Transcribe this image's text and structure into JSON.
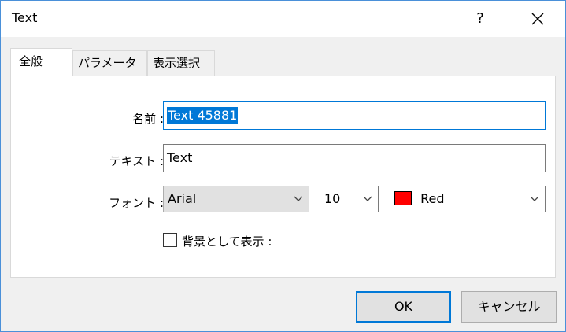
{
  "window": {
    "title": "Text",
    "help_label": "?"
  },
  "tabs": [
    {
      "label": "全般",
      "active": true
    },
    {
      "label": "パラメーター",
      "active": false
    },
    {
      "label": "表示選択",
      "active": false
    }
  ],
  "form": {
    "name_label": "名前 :",
    "name_value": "Text 45881",
    "text_label": "テキスト :",
    "text_value": "Text",
    "font_label": "フォント :",
    "font_family": "Arial",
    "font_size": "10",
    "color_name": "Red",
    "color_hex": "#ff0000",
    "background_label": "背景として表示 :",
    "background_checked": false
  },
  "buttons": {
    "ok_label": "OK",
    "cancel_label": "キャンセル"
  },
  "colors": {
    "accent": "#0078d7",
    "selection": "#0078d7",
    "window_border": "#4a90d9"
  },
  "icons": {
    "close": "close-icon",
    "dropdown": "chevron-down-icon"
  }
}
